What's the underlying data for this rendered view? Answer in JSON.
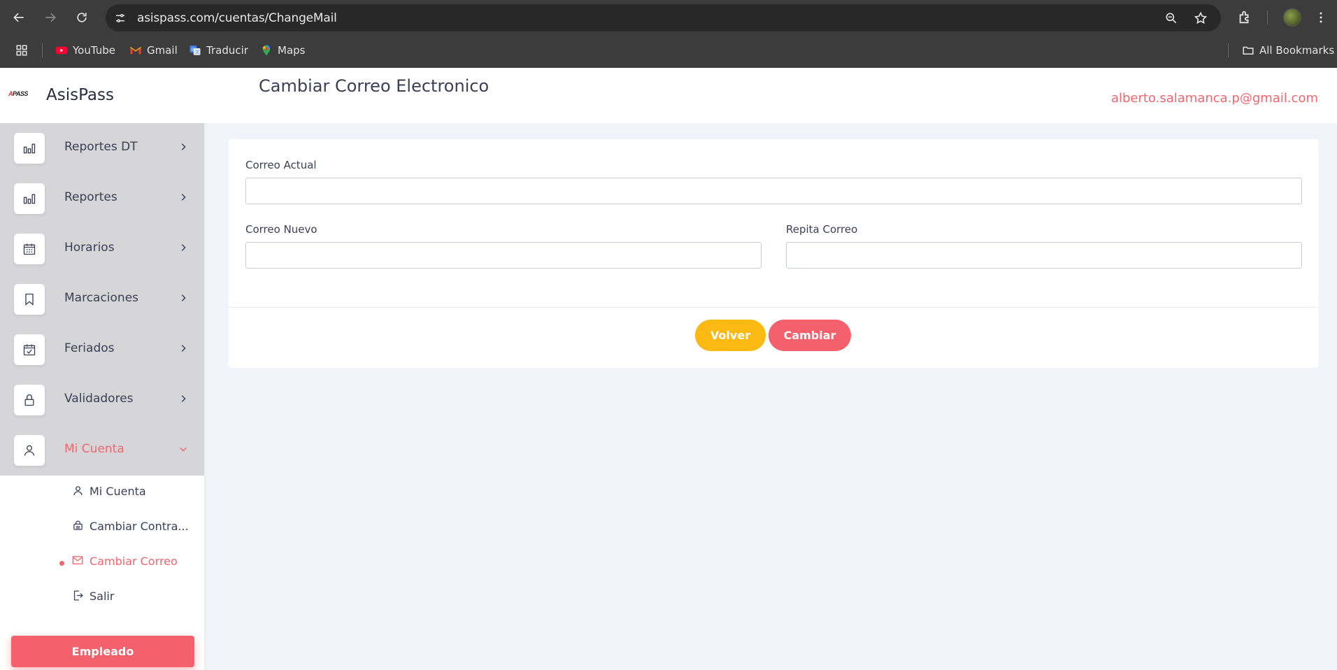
{
  "browser": {
    "url": "asispass.com/cuentas/ChangeMail",
    "bookmarks": [
      {
        "label": "YouTube",
        "icon": "youtube-icon"
      },
      {
        "label": "Gmail",
        "icon": "gmail-icon"
      },
      {
        "label": "Traducir",
        "icon": "translate-icon"
      },
      {
        "label": "Maps",
        "icon": "maps-icon"
      }
    ],
    "all_bookmarks_label": "All Bookmarks"
  },
  "brand": {
    "logo_text": "ASISPASS",
    "name": "AsisPass"
  },
  "menu": {
    "items": [
      {
        "label": "Reportes DT",
        "icon": "bar-chart-icon"
      },
      {
        "label": "Reportes",
        "icon": "bar-chart-icon"
      },
      {
        "label": "Horarios",
        "icon": "calendar-icon"
      },
      {
        "label": "Marcaciones",
        "icon": "bookmark-icon"
      },
      {
        "label": "Feriados",
        "icon": "calendar-check-icon"
      },
      {
        "label": "Validadores",
        "icon": "lock-icon"
      },
      {
        "label": "Mi Cuenta",
        "icon": "user-icon",
        "active": true
      }
    ],
    "submenu": [
      {
        "label": "Mi Cuenta",
        "icon": "user-icon"
      },
      {
        "label": "Cambiar Contra...",
        "icon": "key-icon"
      },
      {
        "label": "Cambiar Correo",
        "icon": "mail-icon",
        "active": true
      },
      {
        "label": "Salir",
        "icon": "logout-icon"
      }
    ],
    "role_button": "Empleado"
  },
  "header": {
    "title": "Cambiar Correo Electronico",
    "user_email": "alberto.salamanca.p@gmail.com"
  },
  "form": {
    "current_label": "Correo Actual",
    "current_value": "",
    "new_label": "Correo Nuevo",
    "new_value": "",
    "repeat_label": "Repita Correo",
    "repeat_value": "",
    "back_button": "Volver",
    "submit_button": "Cambiar"
  },
  "colors": {
    "accent": "#f26670",
    "warning": "#fbb911",
    "menu_bg": "#d6d6d9"
  }
}
